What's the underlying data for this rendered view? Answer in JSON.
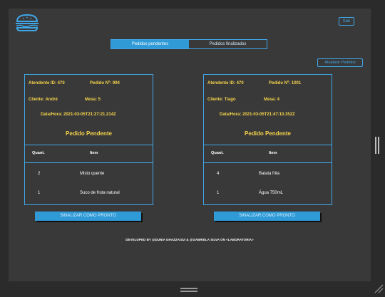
{
  "header": {
    "logout_label": "Sair"
  },
  "tabs": [
    {
      "label": "Pedidos pendentes",
      "active": true
    },
    {
      "label": "Pedidos finalizados",
      "active": false
    }
  ],
  "refresh_label": "Atualizar Pedidos",
  "orders": [
    {
      "attendant_label": "Atendente ID: 470",
      "order_label": "Pedido Nº: 994",
      "client_label": "Cliente: André",
      "table_label": "Mesa: 5",
      "datetime_label": "Data/Hora: 2021-03-05T21:27:21.214Z",
      "status": "Pedido Pendente",
      "col_qty": "Quant.",
      "col_item": "Item",
      "items": [
        {
          "qty": "2",
          "name": "Misto quente"
        },
        {
          "qty": "1",
          "name": "Suco de fruta natural"
        }
      ],
      "ready_label": "SINALIZAR COMO PRONTO"
    },
    {
      "attendant_label": "Atendente ID: 470",
      "order_label": "Pedido Nº: 1001",
      "client_label": "Cliente: Tiago",
      "table_label": "Mesa: 4",
      "datetime_label": "Data/Hora: 2021-03-05T21:47:10.352Z",
      "status": "Pedido Pendente",
      "col_qty": "Quant.",
      "col_item": "Item",
      "items": [
        {
          "qty": "4",
          "name": "Batata frita"
        },
        {
          "qty": "1",
          "name": "Água 750mL"
        }
      ],
      "ready_label": "SINALIZAR COMO PRONTO"
    }
  ],
  "footer_text": "DEVELOPED BY  @DUNIA GHAZZAOUI  &  @GABRIELA SILVA  ON  <LABORATORIA>",
  "colors": {
    "accent": "#3fa6e8",
    "highlight": "#f2d24a",
    "panel": "#3a3939",
    "background": "#2b2b2b"
  },
  "icons": {
    "logo": "burger-logo-icon"
  }
}
